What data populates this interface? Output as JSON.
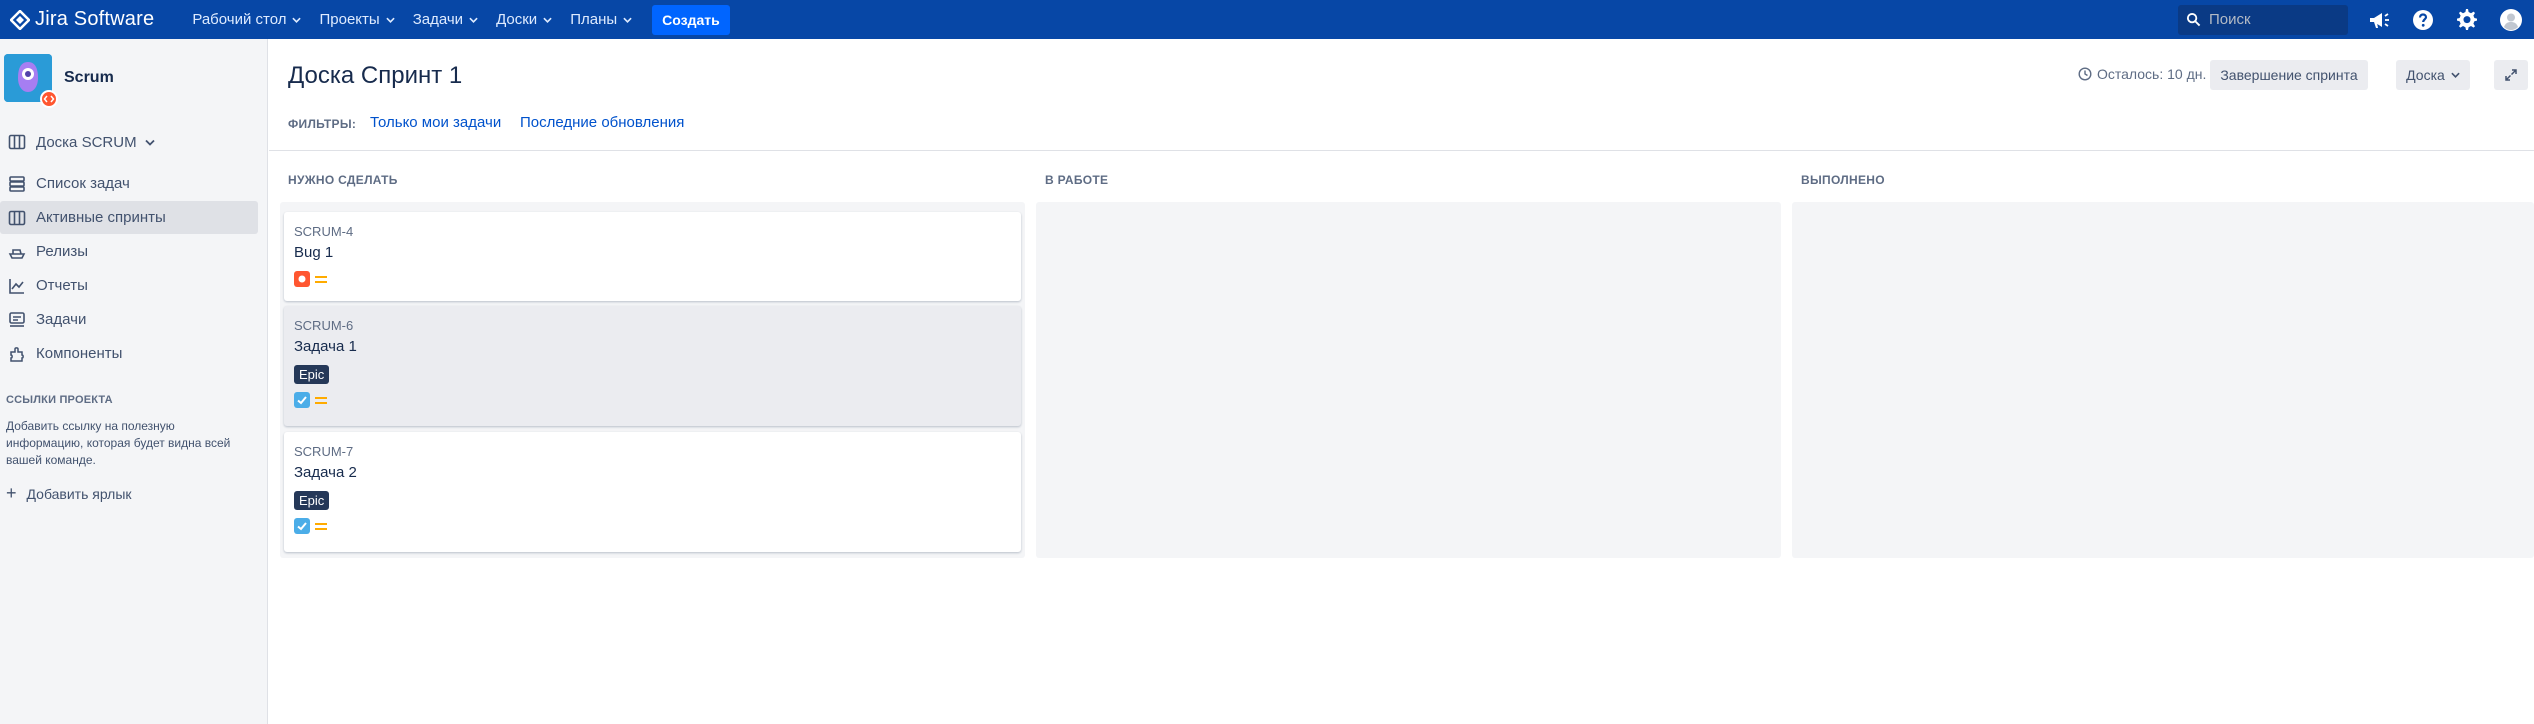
{
  "topnav": {
    "logo_text": "Jira Software",
    "menu": [
      "Рабочий стол",
      "Проекты",
      "Задачи",
      "Доски",
      "Планы"
    ],
    "create_label": "Создать",
    "search_placeholder": "Поиск"
  },
  "sidebar": {
    "project_name": "Scrum",
    "board_label": "Доска SCRUM",
    "items": [
      {
        "label": "Список задач",
        "icon": "backlog-icon"
      },
      {
        "label": "Активные спринты",
        "icon": "board-icon",
        "active": true
      },
      {
        "label": "Релизы",
        "icon": "ship-icon"
      },
      {
        "label": "Отчеты",
        "icon": "chart-icon"
      },
      {
        "label": "Задачи",
        "icon": "issues-icon"
      },
      {
        "label": "Компоненты",
        "icon": "component-icon"
      }
    ],
    "links_section_title": "ССЫЛКИ ПРОЕКТА",
    "links_description": "Добавить ссылку на полезную информацию, которая будет видна всей вашей команде.",
    "add_shortcut_label": "Добавить ярлык"
  },
  "header": {
    "title": "Доска Спринт 1",
    "filters_label": "ФИЛЬТРЫ:",
    "filters": [
      "Только мои задачи",
      "Последние обновления"
    ],
    "remaining": "Осталось: 10 дн.",
    "complete_sprint_label": "Завершение спринта",
    "board_menu_label": "Доска"
  },
  "columns": [
    {
      "title": "НУЖНО СДЕЛАТЬ"
    },
    {
      "title": "В РАБОТЕ"
    },
    {
      "title": "ВЫПОЛНЕНО"
    }
  ],
  "cards": [
    {
      "key": "SCRUM-4",
      "summary": "Bug 1",
      "type": "bug",
      "epic": null,
      "priority": "medium"
    },
    {
      "key": "SCRUM-6",
      "summary": "Задача 1",
      "type": "task",
      "epic": "Epic",
      "priority": "medium"
    },
    {
      "key": "SCRUM-7",
      "summary": "Задача 2",
      "type": "task",
      "epic": "Epic",
      "priority": "medium"
    }
  ],
  "colors": {
    "nav_bg": "#0747a6",
    "create_button": "#0065ff",
    "bug": "#ff5630",
    "task": "#4bade8",
    "priority_medium": "#ffab00",
    "epic_label": "#253858"
  }
}
